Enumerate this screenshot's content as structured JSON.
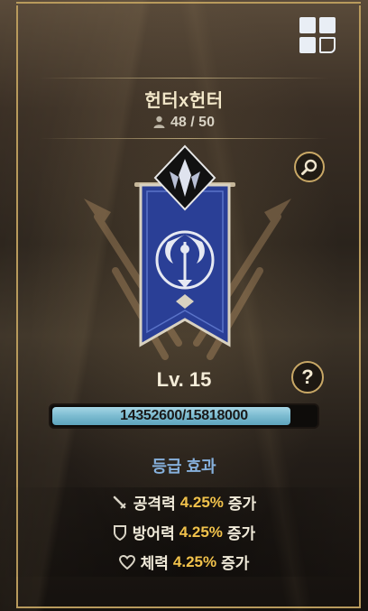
{
  "guild": {
    "name": "헌터x헌터",
    "members": "48 / 50"
  },
  "level": {
    "label": "Lv. 15",
    "xp_text": "14352600/15818000",
    "xp_fraction": 0.907
  },
  "effects": {
    "title": "등급 효과",
    "items": [
      {
        "icon": "sword-icon",
        "name": "공격력",
        "value": "4.25%",
        "suffix": "증가"
      },
      {
        "icon": "shield-icon",
        "name": "방어력",
        "value": "4.25%",
        "suffix": "증가"
      },
      {
        "icon": "heart-icon",
        "name": "체력",
        "value": "4.25%",
        "suffix": "증가"
      }
    ]
  },
  "buttons": {
    "help_label": "?"
  },
  "colors": {
    "accent_gold": "#c9a866",
    "banner_blue": "#2a3f96",
    "effect_value": "#f1c24b",
    "effect_title": "#86b0dc",
    "xp_fill": "#7bbbd0"
  }
}
